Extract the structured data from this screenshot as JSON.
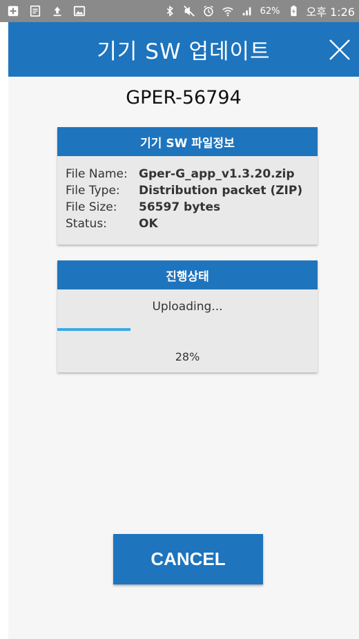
{
  "status_bar": {
    "battery_percent": "62%",
    "time": "오후 1:26",
    "icons": [
      "add-box-icon",
      "notes-icon",
      "upload-icon",
      "image-icon",
      "bluetooth-icon",
      "mute-icon",
      "alarm-icon",
      "wifi-icon",
      "signal-icon",
      "battery-charging-icon"
    ]
  },
  "header": {
    "title": "기기 SW 업데이트",
    "close_icon": "close-icon"
  },
  "device": {
    "id": "GPER-56794"
  },
  "file_info": {
    "title": "기기 SW 파일정보",
    "rows": [
      {
        "label": "File Name:",
        "value": "Gper-G_app_v1.3.20.zip"
      },
      {
        "label": "File Type:",
        "value": "Distribution packet (ZIP)"
      },
      {
        "label": "File Size:",
        "value": "56597 bytes"
      },
      {
        "label": "Status:",
        "value": "OK"
      }
    ]
  },
  "progress": {
    "title": "진행상태",
    "status_text": "Uploading...",
    "percent_text": "28%",
    "percent_value": 28
  },
  "actions": {
    "cancel_label": "CANCEL"
  },
  "colors": {
    "primary": "#1e74bd",
    "progress": "#3aa9e6",
    "card_bg": "#e9e9e9"
  }
}
